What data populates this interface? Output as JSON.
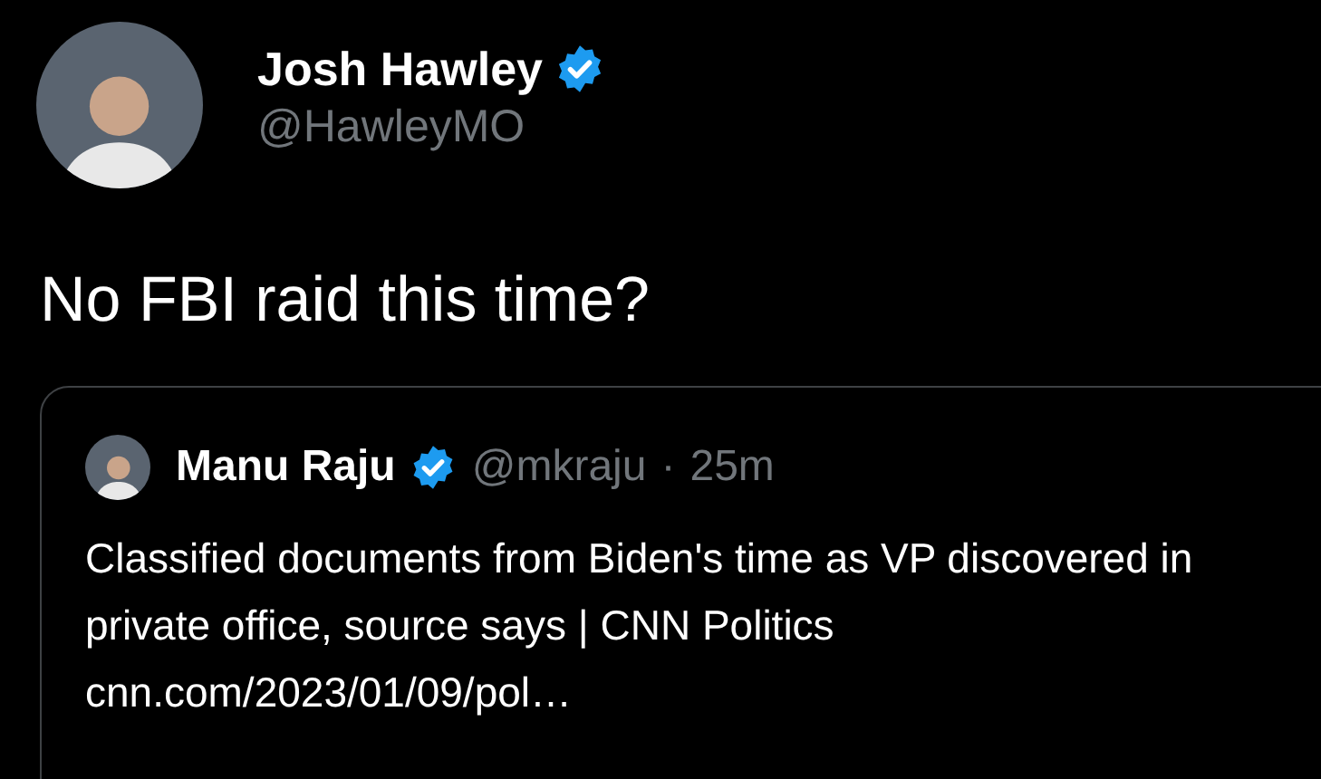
{
  "author": {
    "name": "Josh Hawley",
    "verified": true,
    "handle": "@HawleyMO"
  },
  "text": "No FBI raid this time?",
  "quote": {
    "author": {
      "name": "Manu Raju",
      "verified": true,
      "handle": "@mkraju",
      "separator": "·",
      "time": "25m"
    },
    "text": "Classified documents from Biden's time as VP discovered in private office, source says | CNN Politics cnn.com/2023/01/09/pol…"
  }
}
